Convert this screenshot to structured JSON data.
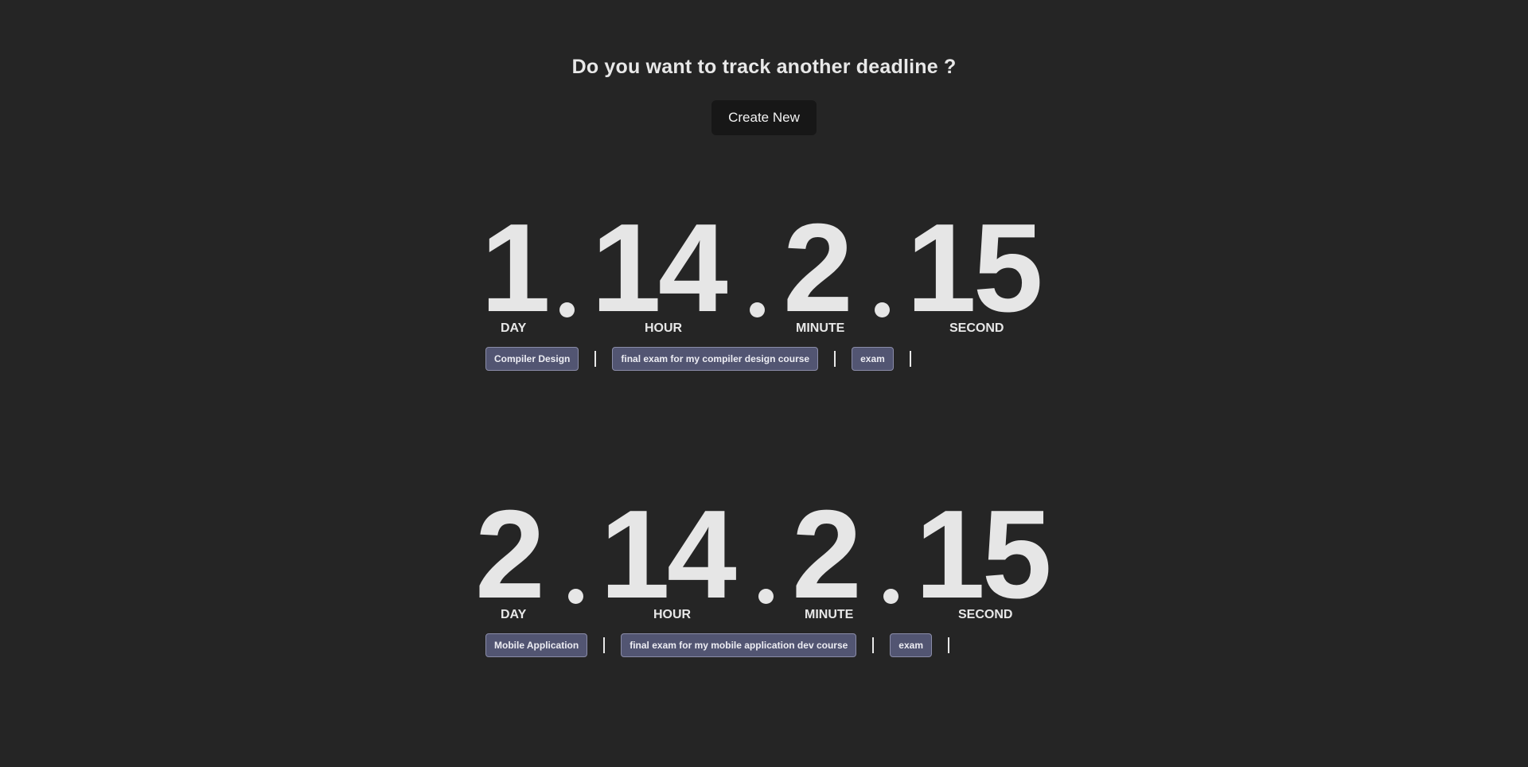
{
  "header": {
    "prompt": "Do you want to track another deadline ?",
    "create_button_label": "Create New"
  },
  "timers": [
    {
      "day": "1",
      "hour": "14",
      "minute": "2",
      "second": "15",
      "labels": {
        "day": "DAY",
        "hour": "HOUR",
        "minute": "MINUTE",
        "second": "SECOND"
      },
      "tags": [
        "Compiler Design",
        "final exam for my compiler design course",
        "exam"
      ]
    },
    {
      "day": "2",
      "hour": "14",
      "minute": "2",
      "second": "15",
      "labels": {
        "day": "DAY",
        "hour": "HOUR",
        "minute": "MINUTE",
        "second": "SECOND"
      },
      "tags": [
        "Mobile Application",
        "final exam for my mobile application dev course",
        "exam"
      ]
    }
  ],
  "colors": {
    "background": "#252525",
    "text": "#e8e8e8",
    "button_bg": "#171717",
    "tag_bg": "#525572",
    "tag_border": "#8a8ca8"
  }
}
